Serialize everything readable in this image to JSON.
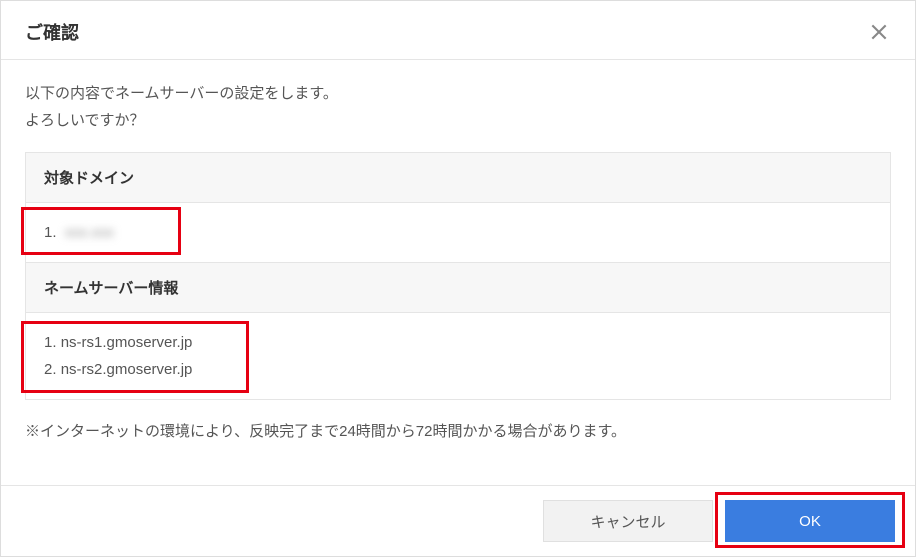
{
  "dialog": {
    "title": "ご確認",
    "intro_line1": "以下の内容でネームサーバーの設定をします。",
    "intro_line2": "よろしいですか？",
    "note": "※インターネットの環境により、反映完了まで24時間から72時間かかる場合があります。"
  },
  "sections": {
    "domain": {
      "header": "対象ドメイン",
      "items": [
        {
          "num": "1.",
          "value": "xxx.xxx"
        }
      ]
    },
    "nameserver": {
      "header": "ネームサーバー情報",
      "items": [
        {
          "num": "1.",
          "value": "ns-rs1.gmoserver.jp"
        },
        {
          "num": "2.",
          "value": "ns-rs2.gmoserver.jp"
        }
      ]
    }
  },
  "footer": {
    "cancel_label": "キャンセル",
    "ok_label": "OK"
  }
}
